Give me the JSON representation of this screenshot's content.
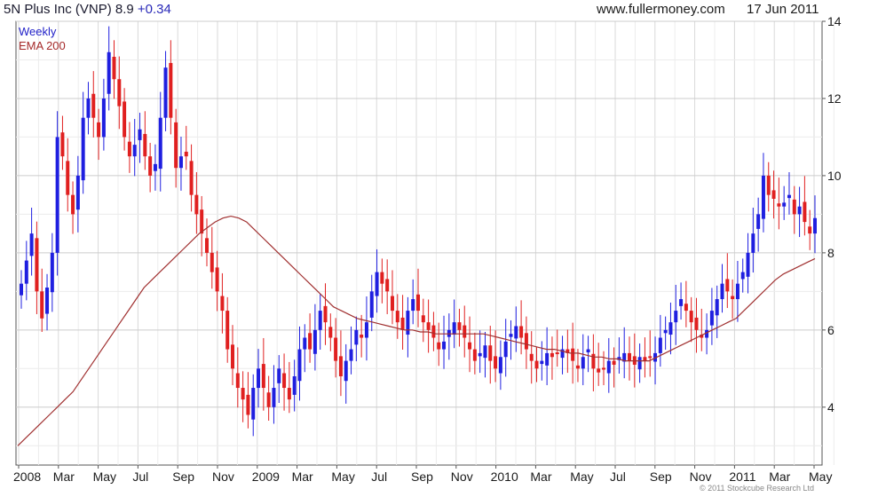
{
  "header": {
    "title_main": "5N Plus Inc (VNP) 8.9",
    "title_change": "+0.34",
    "source": "www.fullermoney.com",
    "date": "17 Jun 2011"
  },
  "legend": {
    "weekly": "Weekly",
    "ema": "EMA 200"
  },
  "footer": {
    "copyright": "© 2011 Stockcube Research Ltd"
  },
  "colors": {
    "up": "#1f1fe0",
    "down": "#e02020",
    "ema": "#a03030",
    "grid": "#d9d9d9"
  },
  "chart_data": {
    "type": "candlestick",
    "title": "5N Plus Inc (VNP) 8.9 +0.34",
    "xlabel": "",
    "ylabel": "",
    "ylim": [
      2.5,
      14
    ],
    "y_ticks": [
      4,
      6,
      8,
      10,
      12,
      14
    ],
    "x_ticks": [
      "2008",
      "Mar",
      "May",
      "Jul",
      "Sep",
      "Nov",
      "2009",
      "Mar",
      "May",
      "Jul",
      "Sep",
      "Nov",
      "2010",
      "Mar",
      "May",
      "Jul",
      "Sep",
      "Nov",
      "2011",
      "Mar",
      "May"
    ],
    "grid": true,
    "series_names": [
      "Weekly",
      "EMA 200"
    ],
    "weekly_close": [
      7.2,
      7.8,
      8.5,
      7.0,
      6.3,
      7.1,
      8.0,
      11.0,
      10.5,
      9.5,
      9.0,
      10.0,
      11.5,
      12.0,
      11.5,
      11.0,
      12.0,
      13.2,
      12.5,
      11.8,
      11.0,
      10.5,
      10.8,
      11.2,
      10.5,
      10.0,
      10.3,
      11.5,
      12.8,
      11.5,
      10.2,
      10.5,
      10.5,
      9.5,
      9.0,
      8.5,
      8.0,
      7.5,
      7.0,
      6.5,
      5.5,
      5.0,
      4.5,
      4.2,
      3.8,
      4.5,
      5.0,
      4.5,
      4.0,
      4.5,
      5.0,
      4.5,
      4.2,
      4.8,
      5.5,
      5.8,
      5.5,
      6.0,
      6.5,
      6.2,
      5.8,
      5.2,
      4.8,
      5.2,
      5.5,
      6.0,
      5.8,
      6.2,
      7.0,
      7.5,
      7.2,
      7.0,
      6.5,
      6.2,
      6.0,
      6.5,
      6.8,
      6.5,
      6.2,
      6.0,
      5.8,
      5.5,
      5.7,
      6.0,
      6.2,
      6.0,
      5.8,
      5.5,
      5.2,
      5.4,
      5.6,
      5.2,
      5.0,
      5.3,
      5.7,
      5.9,
      6.1,
      5.8,
      5.5,
      5.2,
      5.0,
      5.2,
      5.4,
      5.3,
      5.4,
      5.5,
      5.4,
      5.2,
      5.0,
      5.3,
      5.5,
      5.0,
      4.9,
      5.0,
      5.2,
      5.1,
      5.3,
      5.4,
      5.2,
      5.1,
      5.3,
      5.2,
      5.3,
      5.4,
      5.8,
      6.0,
      6.2,
      6.5,
      6.8,
      6.5,
      6.2,
      6.0,
      5.8,
      6.0,
      6.5,
      6.8,
      7.2,
      7.0,
      6.8,
      7.2,
      7.5,
      8.0,
      8.5,
      9.0,
      10.0,
      9.5,
      9.4,
      9.2,
      9.3,
      9.5,
      9.0,
      9.2,
      8.8,
      8.5,
      8.9
    ],
    "ema200": [
      3.0,
      3.2,
      3.4,
      3.6,
      3.8,
      4.0,
      4.2,
      4.4,
      4.7,
      5.0,
      5.3,
      5.6,
      5.9,
      6.2,
      6.5,
      6.8,
      7.1,
      7.3,
      7.5,
      7.7,
      7.9,
      8.1,
      8.3,
      8.5,
      8.65,
      8.8,
      8.9,
      8.95,
      8.9,
      8.8,
      8.6,
      8.4,
      8.2,
      8.0,
      7.8,
      7.6,
      7.4,
      7.2,
      7.0,
      6.8,
      6.6,
      6.5,
      6.4,
      6.3,
      6.25,
      6.2,
      6.15,
      6.1,
      6.05,
      6.0,
      6.0,
      5.95,
      5.95,
      5.9,
      5.9,
      5.9,
      5.9,
      5.9,
      5.9,
      5.9,
      5.85,
      5.8,
      5.75,
      5.7,
      5.65,
      5.6,
      5.55,
      5.5,
      5.5,
      5.45,
      5.4,
      5.4,
      5.35,
      5.3,
      5.3,
      5.25,
      5.25,
      5.2,
      5.2,
      5.2,
      5.2,
      5.3,
      5.4,
      5.5,
      5.6,
      5.7,
      5.8,
      5.9,
      6.0,
      6.1,
      6.2,
      6.3,
      6.5,
      6.7,
      6.9,
      7.1,
      7.3,
      7.45,
      7.55,
      7.65,
      7.75,
      7.85
    ]
  }
}
